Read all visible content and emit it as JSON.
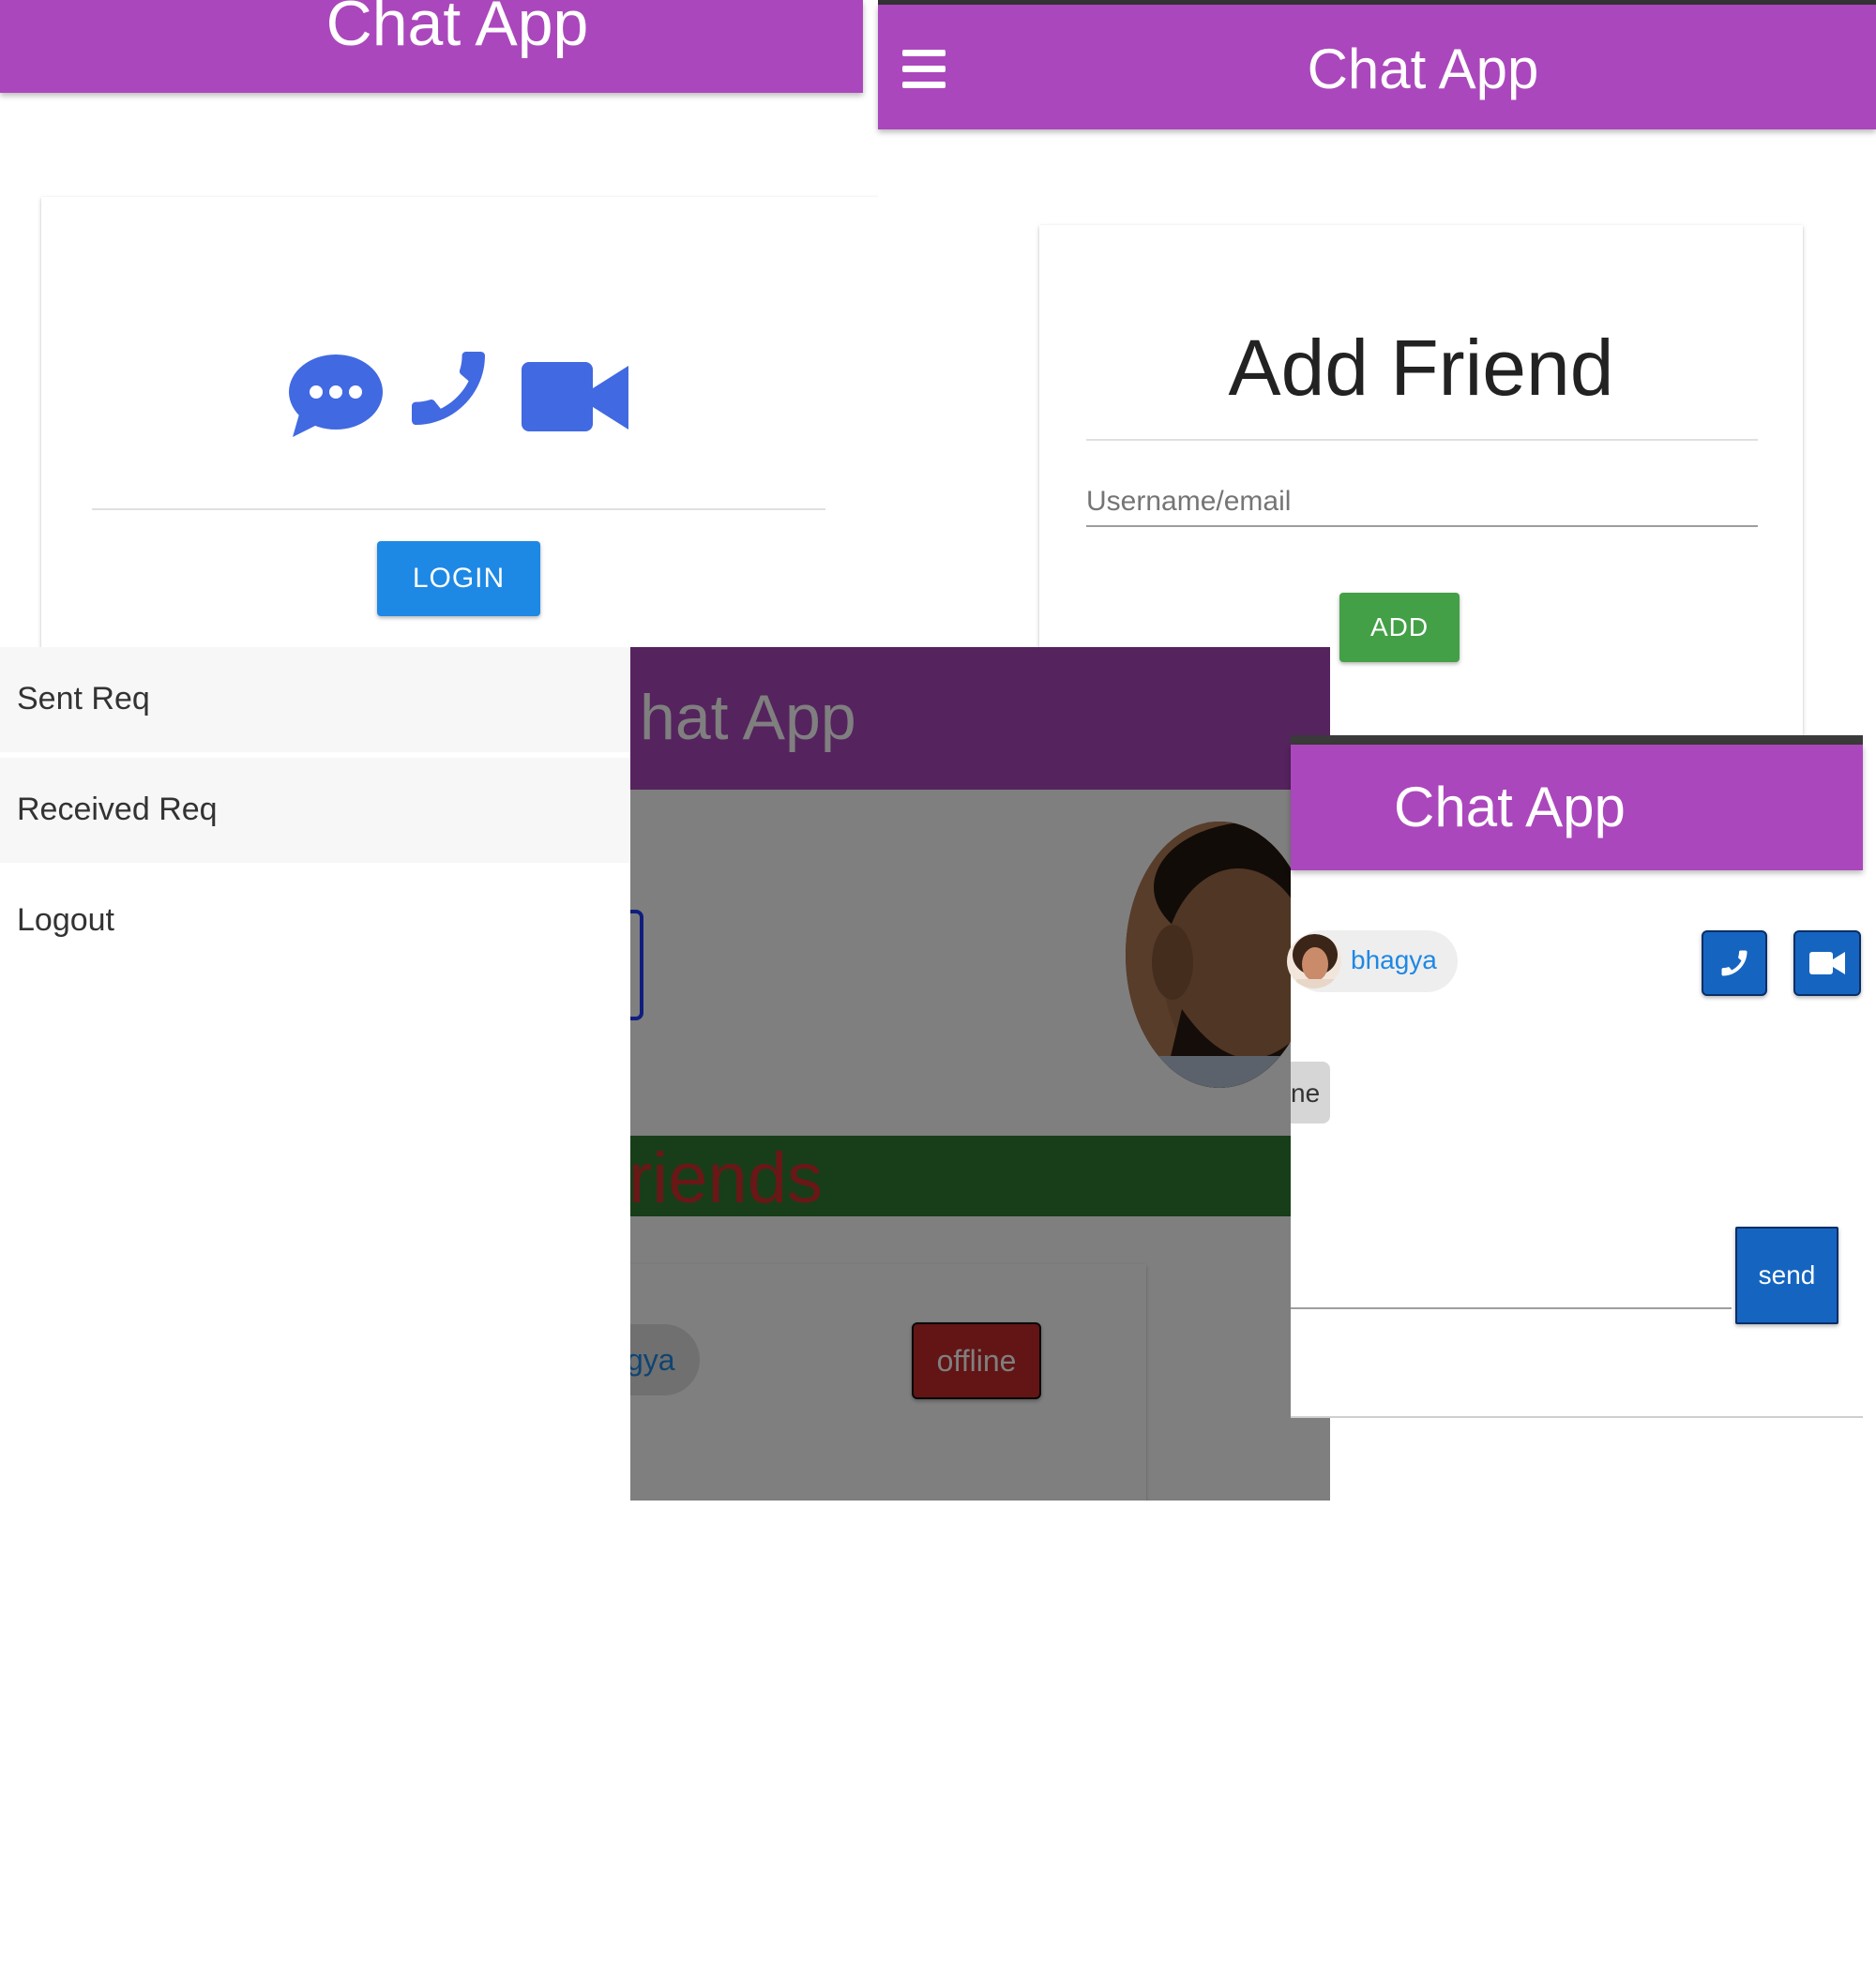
{
  "login_screen": {
    "title": "Chat App",
    "login_button": "LOGIN",
    "icons": [
      "chat-bubble-icon",
      "phone-icon",
      "video-camera-icon"
    ],
    "accent_color": "#4169e1"
  },
  "add_friend_screen": {
    "title": "Chat App",
    "menu_icon": "hamburger-icon",
    "heading": "Add Friend",
    "input_placeholder": "Username/email",
    "input_value": "",
    "add_button": "ADD"
  },
  "drawer": {
    "items": [
      {
        "label": "Sent Req"
      },
      {
        "label": "Received Req"
      },
      {
        "label": "Logout"
      }
    ]
  },
  "friends_screen": {
    "title": "hat App",
    "section_title": "riends",
    "friend_name_partial": "gya",
    "status_button": "offline"
  },
  "chat_screen": {
    "title": "Chat App",
    "contact_name": "bhagya",
    "message_partial": "ne",
    "send_button": "send",
    "call_icon": "phone-icon",
    "video_icon": "video-camera-icon"
  },
  "colors": {
    "appbar": "#ab47bc",
    "login_button": "#1e88e5",
    "add_button": "#43a047",
    "call_buttons": "#1565c0",
    "friends_banner": "#2e7d32",
    "friends_title_text": "#d32f2f",
    "offline_button": "#c62828"
  }
}
